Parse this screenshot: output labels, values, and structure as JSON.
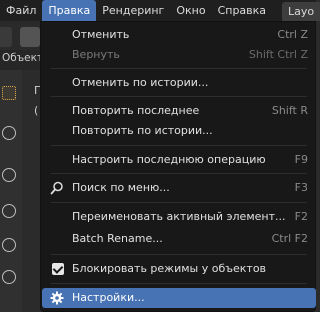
{
  "menubar": {
    "file": "Файл",
    "edit": "Правка",
    "render": "Рендеринг",
    "window": "Окно",
    "help": "Справка",
    "workspace_tab": "Layo"
  },
  "background": {
    "mode_label": "Объект",
    "viewport_text_1": "Г",
    "viewport_text_2": "("
  },
  "edit_menu": {
    "undo": {
      "label": "Отменить",
      "shortcut": "Ctrl Z"
    },
    "redo": {
      "label": "Вернуть",
      "shortcut": "Shift Ctrl Z"
    },
    "undo_history": {
      "label": "Отменить по истории..."
    },
    "repeat_last": {
      "label": "Повторить последнее",
      "shortcut": "Shift R"
    },
    "repeat_history": {
      "label": "Повторить по истории..."
    },
    "adjust_last": {
      "label": "Настроить последнюю операцию",
      "shortcut": "F9"
    },
    "menu_search": {
      "label": "Поиск по меню...",
      "shortcut": "F3"
    },
    "rename_active": {
      "label": "Переименовать активный элемент...",
      "shortcut": "F2"
    },
    "batch_rename": {
      "label": "Batch Rename...",
      "shortcut": "Ctrl F2"
    },
    "lock_object_modes": {
      "label": "Блокировать режимы у объектов",
      "checked": true
    },
    "preferences": {
      "label": "Настройки..."
    }
  },
  "colors": {
    "accent": "#4772b3",
    "menu_bg": "#181818"
  }
}
